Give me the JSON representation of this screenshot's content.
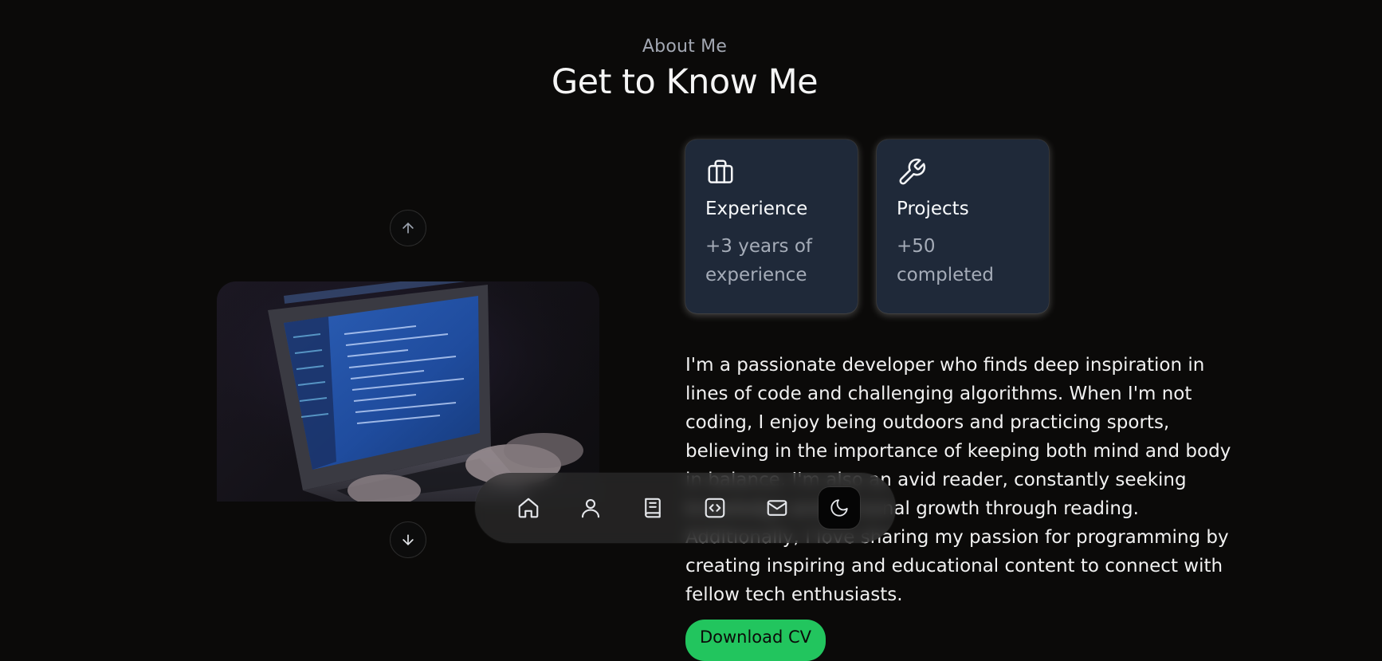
{
  "header": {
    "kicker": "About Me",
    "title": "Get to Know Me"
  },
  "carousel": {
    "prev_icon": "arrow-up-icon",
    "next_icon": "arrow-down-icon",
    "image_alt": "Hands typing code on a laptop in a dark room"
  },
  "cards": [
    {
      "icon": "briefcase-icon",
      "title": "Experience",
      "desc": "+3 years of experience"
    },
    {
      "icon": "wrench-icon",
      "title": "Projects",
      "desc": "+50 completed"
    }
  ],
  "bio": "I'm a passionate developer who finds deep inspiration in lines of code and challenging algorithms. When I'm not coding, I enjoy being outdoors and practicing sports, believing in the importance of keeping both mind and body in balance. I'm also an avid reader, constantly seeking knowledge and personal growth through reading. Additionally, I love sharing my passion for programming by creating inspiring and educational content to connect with fellow tech enthusiasts.",
  "cta": {
    "label": "Download CV"
  },
  "dock": {
    "items": [
      {
        "icon": "home-icon"
      },
      {
        "icon": "user-icon"
      },
      {
        "icon": "book-icon"
      },
      {
        "icon": "code-icon"
      },
      {
        "icon": "mail-icon"
      },
      {
        "icon": "moon-icon"
      }
    ]
  },
  "colors": {
    "background": "#0b0a09",
    "card": "#1f2939",
    "accent": "#22c55e",
    "muted_text": "#a5acb8"
  }
}
